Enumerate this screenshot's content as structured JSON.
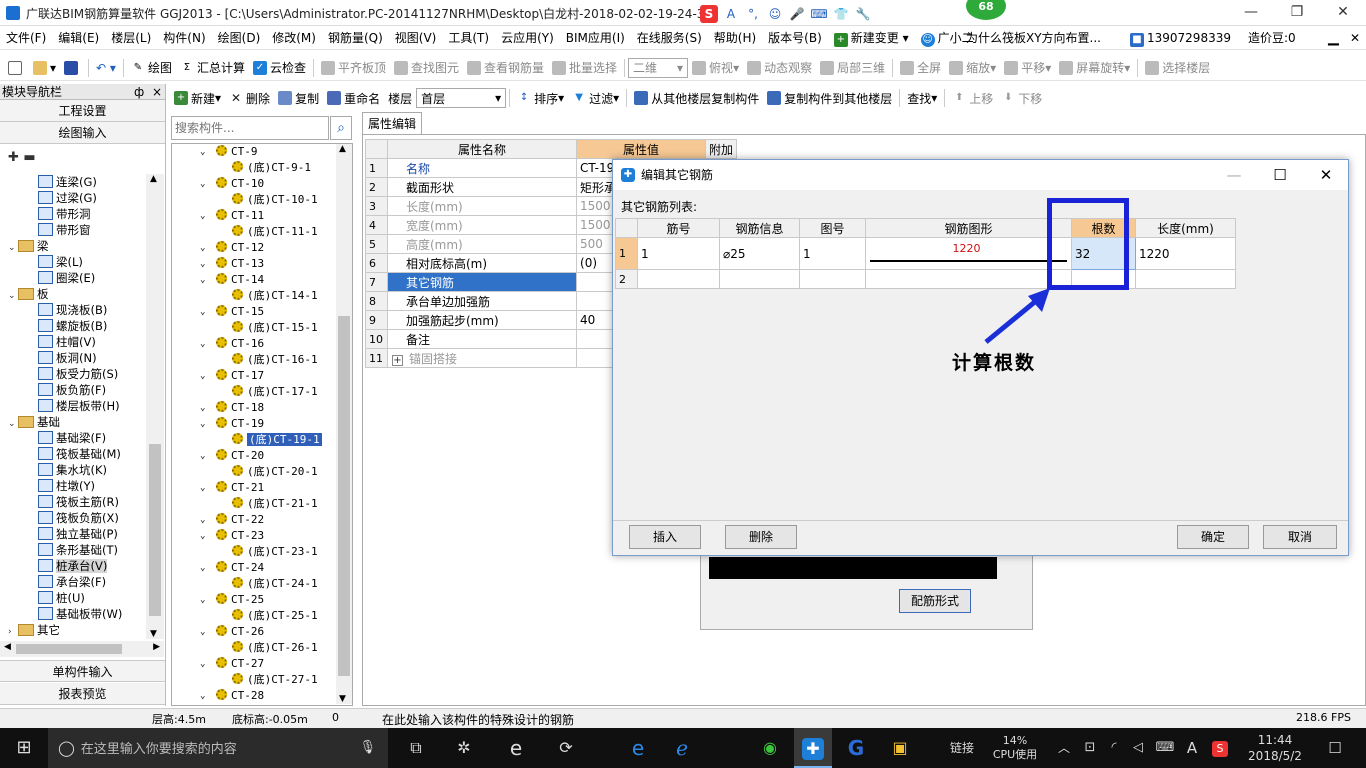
{
  "window": {
    "title": "广联达BIM钢筋算量软件 GGJ2013 - [C:\\Users\\Administrator.PC-20141127NRHM\\Desktop\\白龙村-2018-02-02-19-24-35",
    "bubble": "68",
    "min": "—",
    "restore": "❐",
    "close": "✕"
  },
  "ime": [
    "S",
    "A",
    "°,",
    "☺",
    "🎤",
    "⌨",
    "👕",
    "🔧"
  ],
  "menu": {
    "items": [
      "文件(F)",
      "编辑(E)",
      "楼层(L)",
      "构件(N)",
      "绘图(D)",
      "修改(M)",
      "钢筋量(Q)",
      "视图(V)",
      "工具(T)",
      "云应用(Y)",
      "BIM应用(I)",
      "在线服务(S)",
      "帮助(H)",
      "版本号(B)",
      "新建变更",
      "广小二"
    ],
    "question": "为什么筏板XY方向布置...",
    "phone": "13907298339",
    "coin": "造价豆:0"
  },
  "toolbar": {
    "draw": "绘图",
    "summary": "汇总计算",
    "cloud_check": "云检查",
    "flat_top": "平齐板顶",
    "find": "查找图元",
    "view_qty": "查看钢筋量",
    "batch_select": "批量选择",
    "view_mode": "二维",
    "top_view": "俯视",
    "dynamic": "动态观察",
    "local3d": "局部三维",
    "fullscreen": "全屏",
    "zoom": "缩放",
    "pan": "平移",
    "rotate": "屏幕旋转",
    "select_floor": "选择楼层"
  },
  "nav": {
    "header": "模块导航栏",
    "pin": "ф",
    "close": "×",
    "project_settings": "工程设置",
    "drawing_input": "绘图输入",
    "tree": [
      {
        "label": "连梁(G)",
        "level": 2,
        "type": "item"
      },
      {
        "label": "过梁(G)",
        "level": 2,
        "type": "item"
      },
      {
        "label": "带形洞",
        "level": 2,
        "type": "item"
      },
      {
        "label": "带形窗",
        "level": 2,
        "type": "item"
      },
      {
        "label": "梁",
        "level": 1,
        "type": "folder"
      },
      {
        "label": "梁(L)",
        "level": 2,
        "type": "item"
      },
      {
        "label": "圈梁(E)",
        "level": 2,
        "type": "item"
      },
      {
        "label": "板",
        "level": 1,
        "type": "folder"
      },
      {
        "label": "现浇板(B)",
        "level": 2,
        "type": "item"
      },
      {
        "label": "螺旋板(B)",
        "level": 2,
        "type": "item"
      },
      {
        "label": "柱帽(V)",
        "level": 2,
        "type": "item"
      },
      {
        "label": "板洞(N)",
        "level": 2,
        "type": "item"
      },
      {
        "label": "板受力筋(S)",
        "level": 2,
        "type": "item"
      },
      {
        "label": "板负筋(F)",
        "level": 2,
        "type": "item"
      },
      {
        "label": "楼层板带(H)",
        "level": 2,
        "type": "item"
      },
      {
        "label": "基础",
        "level": 1,
        "type": "folder"
      },
      {
        "label": "基础梁(F)",
        "level": 2,
        "type": "item"
      },
      {
        "label": "筏板基础(M)",
        "level": 2,
        "type": "item"
      },
      {
        "label": "集水坑(K)",
        "level": 2,
        "type": "item"
      },
      {
        "label": "柱墩(Y)",
        "level": 2,
        "type": "item"
      },
      {
        "label": "筏板主筋(R)",
        "level": 2,
        "type": "item"
      },
      {
        "label": "筏板负筋(X)",
        "level": 2,
        "type": "item"
      },
      {
        "label": "独立基础(P)",
        "level": 2,
        "type": "item"
      },
      {
        "label": "条形基础(T)",
        "level": 2,
        "type": "item"
      },
      {
        "label": "桩承台(V)",
        "level": 2,
        "type": "item",
        "selected": true
      },
      {
        "label": "承台梁(F)",
        "level": 2,
        "type": "item"
      },
      {
        "label": "桩(U)",
        "level": 2,
        "type": "item"
      },
      {
        "label": "基础板带(W)",
        "level": 2,
        "type": "item"
      },
      {
        "label": "其它",
        "level": 1,
        "type": "folder"
      }
    ],
    "single_input": "单构件输入",
    "report_preview": "报表预览"
  },
  "toolbar2": {
    "new": "新建",
    "delete": "删除",
    "copy": "复制",
    "rename": "重命名",
    "floor_label": "楼层",
    "floor_value": "首层",
    "sort": "排序",
    "filter": "过滤",
    "copy_from": "从其他楼层复制构件",
    "copy_to": "复制构件到其他楼层",
    "find": "查找",
    "up": "上移",
    "down": "下移"
  },
  "search": {
    "placeholder": "搜索构件..."
  },
  "components": [
    {
      "label": "CT-9",
      "level": 1
    },
    {
      "label": "(底)CT-9-1",
      "level": 2
    },
    {
      "label": "CT-10",
      "level": 1
    },
    {
      "label": "(底)CT-10-1",
      "level": 2
    },
    {
      "label": "CT-11",
      "level": 1
    },
    {
      "label": "(底)CT-11-1",
      "level": 2
    },
    {
      "label": "CT-12",
      "level": 1
    },
    {
      "label": "CT-13",
      "level": 1
    },
    {
      "label": "CT-14",
      "level": 1
    },
    {
      "label": "(底)CT-14-1",
      "level": 2
    },
    {
      "label": "CT-15",
      "level": 1
    },
    {
      "label": "(底)CT-15-1",
      "level": 2
    },
    {
      "label": "CT-16",
      "level": 1
    },
    {
      "label": "(底)CT-16-1",
      "level": 2
    },
    {
      "label": "CT-17",
      "level": 1
    },
    {
      "label": "(底)CT-17-1",
      "level": 2
    },
    {
      "label": "CT-18",
      "level": 1
    },
    {
      "label": "CT-19",
      "level": 1
    },
    {
      "label": "(底)CT-19-1",
      "level": 2,
      "selected": true
    },
    {
      "label": "CT-20",
      "level": 1
    },
    {
      "label": "(底)CT-20-1",
      "level": 2
    },
    {
      "label": "CT-21",
      "level": 1
    },
    {
      "label": "(底)CT-21-1",
      "level": 2
    },
    {
      "label": "CT-22",
      "level": 1
    },
    {
      "label": "CT-23",
      "level": 1
    },
    {
      "label": "(底)CT-23-1",
      "level": 2
    },
    {
      "label": "CT-24",
      "level": 1
    },
    {
      "label": "(底)CT-24-1",
      "level": 2
    },
    {
      "label": "CT-25",
      "level": 1
    },
    {
      "label": "(底)CT-25-1",
      "level": 2
    },
    {
      "label": "CT-26",
      "level": 1
    },
    {
      "label": "(底)CT-26-1",
      "level": 2
    },
    {
      "label": "CT-27",
      "level": 1
    },
    {
      "label": "(底)CT-27-1",
      "level": 2
    },
    {
      "label": "CT-28",
      "level": 1
    }
  ],
  "property": {
    "tab": "属性编辑",
    "headers": [
      "属性名称",
      "属性值",
      "附加"
    ],
    "rows": [
      {
        "n": "1",
        "name": "名称",
        "value": "CT-19-",
        "style": "blue"
      },
      {
        "n": "2",
        "name": "截面形状",
        "value": "矩形承",
        "style": ""
      },
      {
        "n": "3",
        "name": "长度(mm)",
        "value": "1500",
        "style": "gray"
      },
      {
        "n": "4",
        "name": "宽度(mm)",
        "value": "1500",
        "style": "gray"
      },
      {
        "n": "5",
        "name": "高度(mm)",
        "value": "500",
        "style": "gray"
      },
      {
        "n": "6",
        "name": "相对底标高(m)",
        "value": "(0)",
        "style": ""
      },
      {
        "n": "7",
        "name": "其它钢筋",
        "value": "",
        "style": "sel"
      },
      {
        "n": "8",
        "name": "承台单边加强筋",
        "value": "",
        "style": ""
      },
      {
        "n": "9",
        "name": "加强筋起步(mm)",
        "value": "40",
        "style": ""
      },
      {
        "n": "10",
        "name": "备注",
        "value": "",
        "style": ""
      },
      {
        "n": "11",
        "name": "锚固搭接",
        "value": "",
        "style": "gray",
        "expand": "+"
      }
    ]
  },
  "behind_button": "配筋形式",
  "dialog": {
    "title": "编辑其它钢筋",
    "list_label": "其它钢筋列表:",
    "headers": [
      "筋号",
      "钢筋信息",
      "图号",
      "钢筋图形",
      "根数",
      "长度(mm)"
    ],
    "rows": [
      {
        "n": "1",
        "bar_no": "1",
        "info": "⌀25",
        "fig": "1",
        "shape_len": "1220",
        "count": "32",
        "length": "1220"
      },
      {
        "n": "2",
        "bar_no": "",
        "info": "",
        "fig": "",
        "shape_len": "",
        "count": "",
        "length": ""
      }
    ],
    "insert": "插入",
    "delete": "删除",
    "ok": "确定",
    "cancel": "取消"
  },
  "annotation": {
    "text": "计算根数",
    "color": "#1a2fd8"
  },
  "status": {
    "floor_height": "层高:4.5m",
    "bottom_elev": "底标高:-0.05m",
    "zero": "0",
    "hint": "在此处输入该构件的特殊设计的钢筋",
    "fps": "218.6 FPS"
  },
  "taskbar": {
    "search_placeholder": "在这里输入你要搜索的内容",
    "link": "链接",
    "cpu_pct": "14%",
    "cpu_label": "CPU使用",
    "ime_a": "A",
    "time": "11:44",
    "date": "2018/5/2"
  },
  "colors": {
    "selection": "#2f72c8",
    "accent": "#1e7fd8",
    "highlight_box": "#1a22d8"
  }
}
